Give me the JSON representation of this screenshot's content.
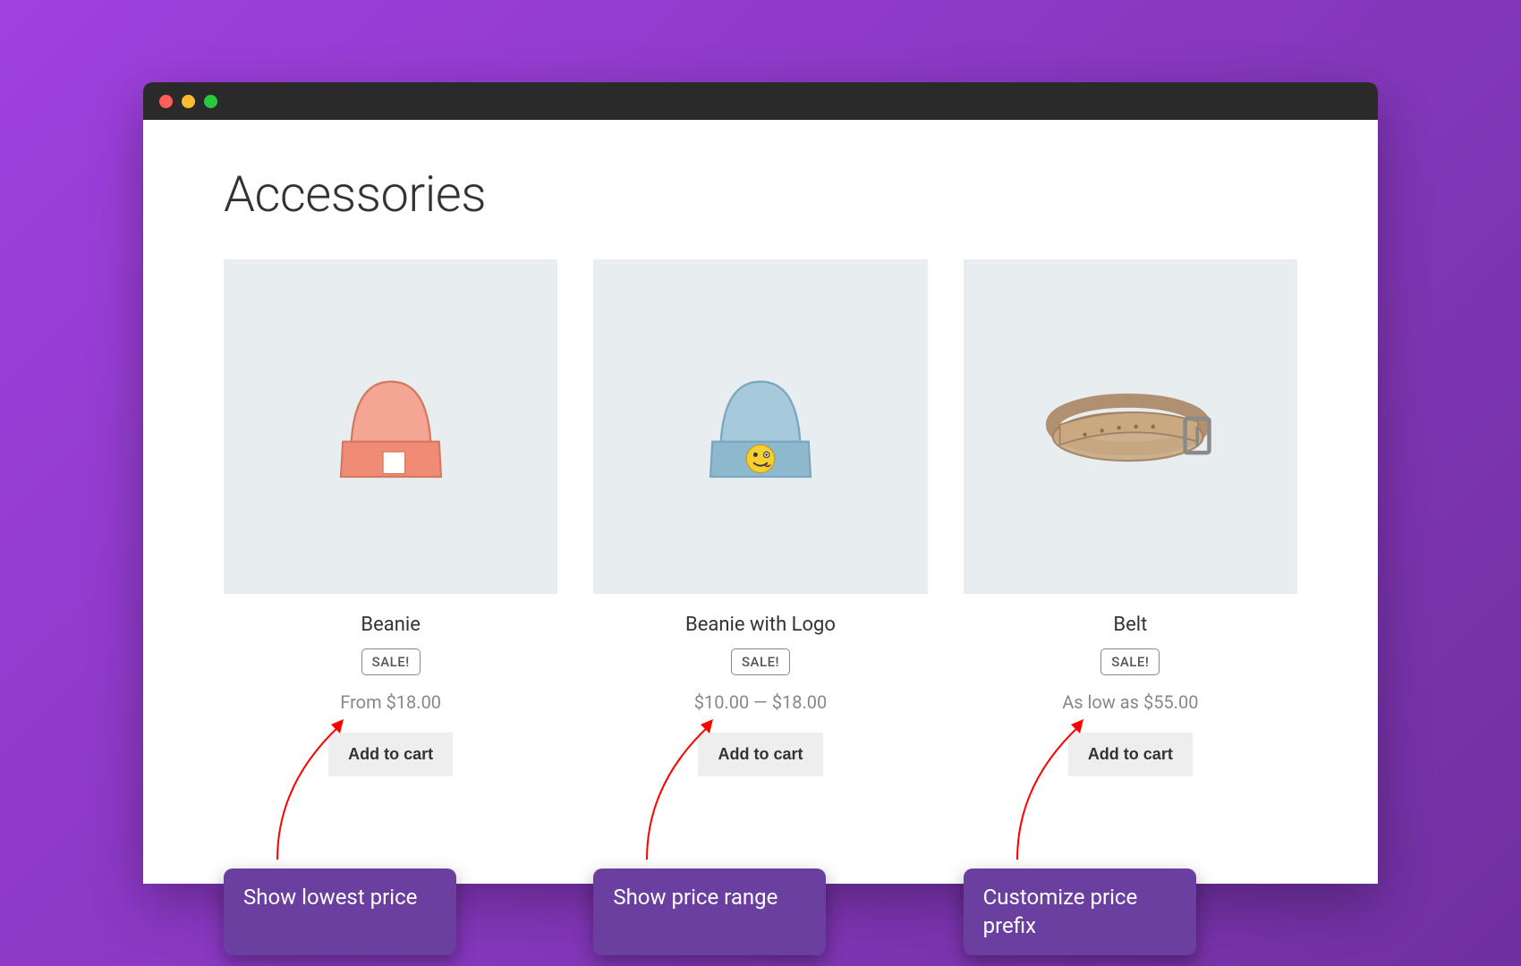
{
  "page": {
    "title": "Accessories"
  },
  "products": [
    {
      "name": "Beanie",
      "badge": "SALE!",
      "price": "From $18.00",
      "button": "Add to cart"
    },
    {
      "name": "Beanie with Logo",
      "badge": "SALE!",
      "price": "$10.00 — $18.00",
      "button": "Add to cart"
    },
    {
      "name": "Belt",
      "badge": "SALE!",
      "price": "As low as $55.00",
      "button": "Add to cart"
    }
  ],
  "callouts": [
    {
      "text": "Show lowest price"
    },
    {
      "text": "Show price range"
    },
    {
      "text": "Customize price prefix"
    }
  ]
}
